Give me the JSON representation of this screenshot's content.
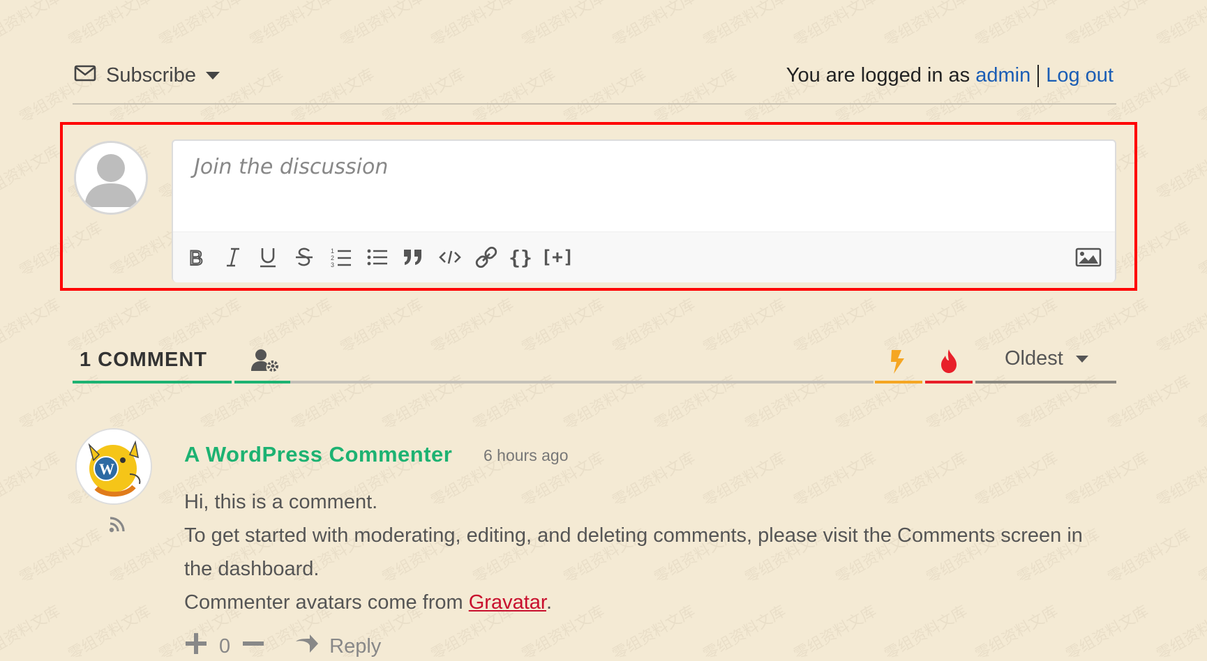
{
  "header": {
    "subscribe_label": "Subscribe",
    "logged_in_text": "You are logged in as",
    "username": "admin",
    "logout_label": "Log out"
  },
  "editor": {
    "placeholder": "Join the discussion",
    "toolbar": [
      "bold",
      "italic",
      "underline",
      "strikethrough",
      "ordered-list",
      "unordered-list",
      "blockquote",
      "code",
      "link",
      "source-code",
      "spoiler",
      "image"
    ],
    "spoiler_label": "[+]",
    "source_code_label": "{}"
  },
  "comments_header": {
    "count_label": "1 COMMENT",
    "sort_label": "Oldest"
  },
  "comment": {
    "author": "A WordPress Commenter",
    "time": "6 hours ago",
    "line1": "Hi, this is a comment.",
    "line2": "To get started with moderating, editing, and deleting comments, please visit the Comments screen in the dashboard.",
    "line3_prefix": "Commenter avatars come from ",
    "line3_link": "Gravatar",
    "line3_suffix": ".",
    "votes": "0",
    "reply_label": "Reply"
  },
  "colors": {
    "background": "#f4ead4",
    "accent_green": "#1db272",
    "link_blue": "#1a5db5",
    "highlight_red": "#ff0000",
    "hot_orange": "#f5a623",
    "hot_red": "#e8202a"
  },
  "watermark": {
    "text": "零组资料文库"
  }
}
